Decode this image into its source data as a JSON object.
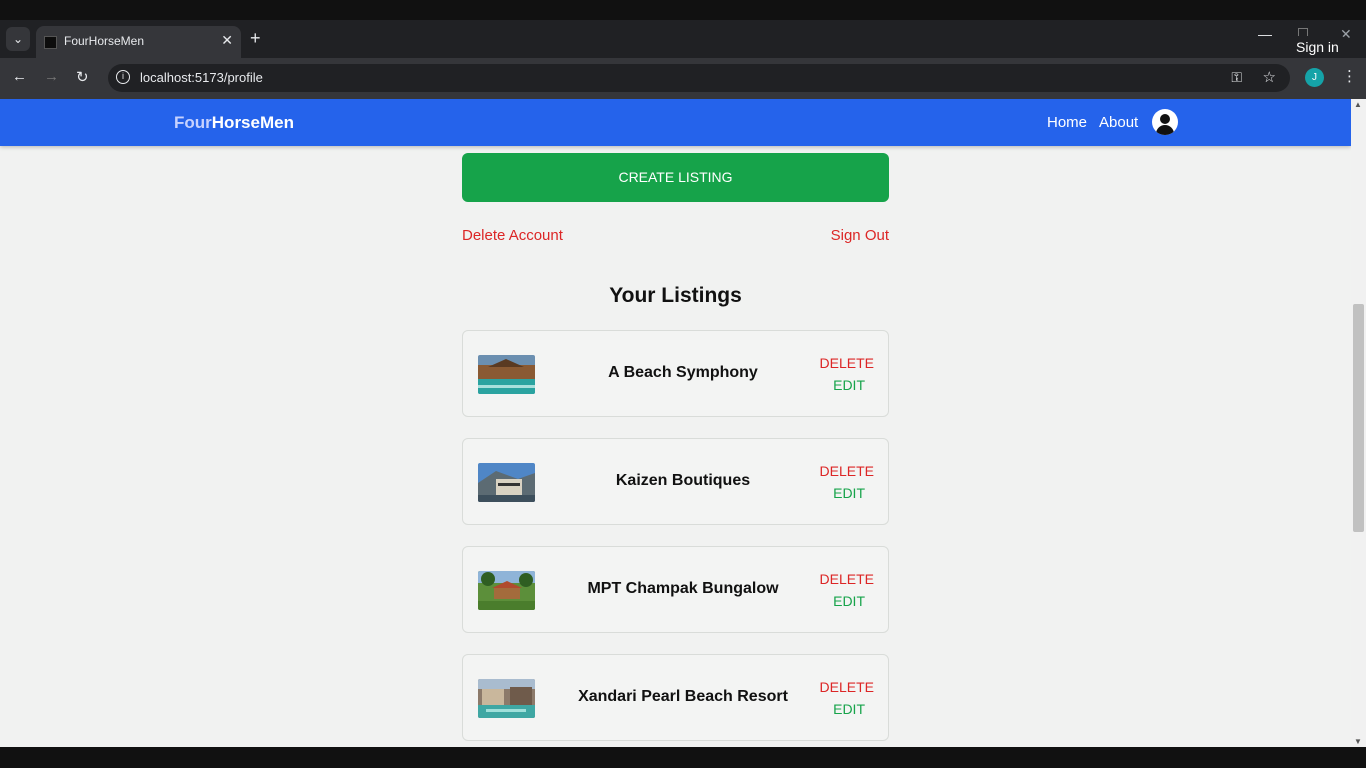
{
  "browser": {
    "tab_title": "FourHorseMen",
    "url": "localhost:5173/profile",
    "signin_tooltip": "Sign in",
    "profile_initial": "J"
  },
  "navbar": {
    "brand_part1": "Four",
    "brand_part2": "HorseMen",
    "links": [
      "Home",
      "About"
    ]
  },
  "profile": {
    "create_listing_label": "CREATE LISTING",
    "delete_account_label": "Delete Account",
    "sign_out_label": "Sign Out",
    "listings_title": "Your Listings"
  },
  "listings": [
    {
      "name": "A Beach Symphony",
      "delete_label": "DELETE",
      "edit_label": "EDIT"
    },
    {
      "name": "Kaizen Boutiques",
      "delete_label": "DELETE",
      "edit_label": "EDIT"
    },
    {
      "name": "MPT Champak Bungalow",
      "delete_label": "DELETE",
      "edit_label": "EDIT"
    },
    {
      "name": "Xandari Pearl Beach Resort",
      "delete_label": "DELETE",
      "edit_label": "EDIT"
    }
  ],
  "colors": {
    "navbar": "#2563eb",
    "create_button": "#16a34a",
    "danger": "#dc2626",
    "edit": "#16a34a"
  }
}
